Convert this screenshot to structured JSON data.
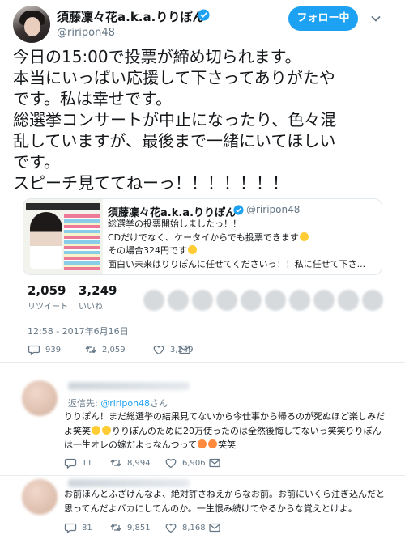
{
  "tweet": {
    "user_name": "須藤凜々花a.k.a.りりぽん",
    "handle": "@riripon48",
    "follow_label": "フォロー中",
    "text_lines": [
      "今日の15:00で投票が締め切られます。",
      "本当にいっぱい応援して下さってありがたや",
      "です。私は幸せです。",
      "総選挙コンサートが中止になったり、色々混",
      "乱していますが、最後まで一緒にいてほしい",
      "です。",
      "スピーチ見ててねーっ！！！！！！！"
    ],
    "quote": {
      "user_name": "須藤凜々花a.k.a.りりぽん",
      "handle": "@riripon48",
      "lines": [
        "総選挙の投票開始しましたっ！！",
        "CDだけでなく、ケータイからでも投票できます",
        "その場合324円です",
        "面白い未来はりりぽんに任せてくださいっ！！私に任せて下さ..."
      ]
    },
    "retweets": {
      "count": "2,059",
      "label": "リツイート"
    },
    "likes": {
      "count": "3,249",
      "label": "いいね"
    },
    "timestamp": "12:58 - 2017年6月16日",
    "actions": {
      "replies": "939",
      "retweets": "2,059",
      "likes": "3,249"
    }
  },
  "replies": [
    {
      "reply_prefix": "返信先: ",
      "reply_mention": "@riripon48",
      "reply_suffix": "さん",
      "line1": "りりぽん！まだ総選挙の結果見てないから今仕事から帰るのが死ぬほど楽しみだ",
      "line2a": "よ笑笑",
      "line2b": "りりぽんのために20万使ったのは全然後悔してないっ笑笑りりぽん",
      "line3a": "は一生オレの嫁だよっなんつって",
      "line3b": "笑笑",
      "actions": {
        "replies": "11",
        "retweets": "8,994",
        "likes": "6,906"
      }
    },
    {
      "line1": "お前ほんとふざけんなよ、絶対許さねえからなお前。お前にいくら注ぎ込んだと",
      "line2": "思ってんだよバカにしてんのか。一生恨み続けてやるからな覚えとけよ。",
      "actions": {
        "replies": "81",
        "retweets": "9,851",
        "likes": "8,168"
      }
    }
  ],
  "colors": {
    "accent": "#1da1f2",
    "text": "#14171a",
    "muted": "#657786",
    "border": "#e1e8ed"
  },
  "icons": [
    "verified-icon",
    "caret-down-icon",
    "reply-icon",
    "retweet-icon",
    "like-icon",
    "message-icon"
  ]
}
